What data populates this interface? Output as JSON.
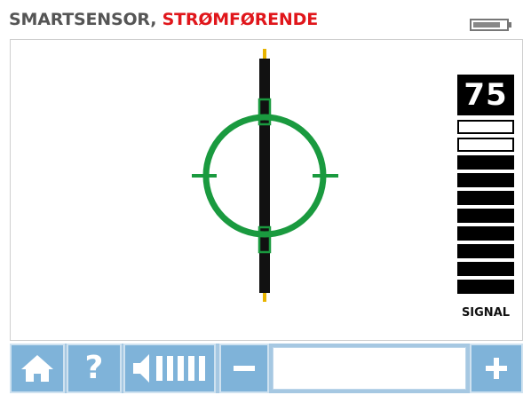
{
  "header": {
    "title_main": "SMARTSENSOR, ",
    "title_mode": "STRØMFØRENDE",
    "battery_icon": "battery-icon"
  },
  "signal": {
    "value": "75",
    "label": "SIGNAL",
    "segments_total": 10,
    "segments_filled": 8
  },
  "toolbar": {
    "home_icon": "home-icon",
    "help_label": "?",
    "volume_icon": "volume-icon",
    "minus_icon": "minus-icon",
    "plus_icon": "plus-icon"
  },
  "colors": {
    "title_gray": "#555555",
    "title_red": "#e0161b",
    "reticle_green": "#1a9a3f",
    "toolbar_bg": "#a6c8e2",
    "button_bg": "#7fb3d9"
  }
}
